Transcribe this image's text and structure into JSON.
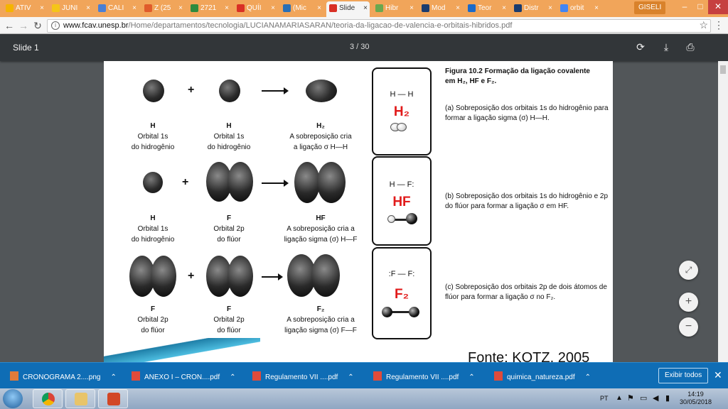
{
  "browser": {
    "tabs": [
      {
        "label": "ATIV",
        "color": "#f5b400"
      },
      {
        "label": "JUNI",
        "color": "#f5c518"
      },
      {
        "label": "CALI",
        "color": "#4a7fd4"
      },
      {
        "label": "Z (25",
        "color": "#e05b2b"
      },
      {
        "label": "2721",
        "color": "#2e8b3e"
      },
      {
        "label": "QUÍI",
        "color": "#d93025"
      },
      {
        "label": "(Mic",
        "color": "#2a6fb5"
      },
      {
        "label": "Slide",
        "color": "#d93025"
      },
      {
        "label": "Hibr",
        "color": "#6aa84f"
      },
      {
        "label": "Mod",
        "color": "#1b3c6e"
      },
      {
        "label": "Teor",
        "color": "#1b6ac9"
      },
      {
        "label": "Distr",
        "color": "#1b3c6e"
      },
      {
        "label": "orbit",
        "color": "#4285f4"
      }
    ],
    "active_tab_index": 7,
    "user": "GISELI",
    "url_host": "www.fcav.unesp.br",
    "url_path": "/Home/departamentos/tecnologia/LUCIANAMARIASARAN/teoria-da-ligacao-de-valencia-e-orbitais-hibridos.pdf"
  },
  "pdf": {
    "title": "Slide 1",
    "page_indicator": "3  /  30"
  },
  "figure": {
    "title_line1": "Figura 10.2 Formação da ligação covalente",
    "title_line2": "em H₂, HF e F₂.",
    "note_a": "(a) Sobreposição dos orbitais 1s do hidrogênio para formar a ligação sigma (σ) H—H.",
    "note_b": "(b) Sobreposição dos orbitais 1s do hidrogênio e 2p do flúor para formar a ligação σ em HF.",
    "note_c": "(c) Sobreposição dos orbitais 2p de dois átomos de flúor para formar a ligação σ no F₂.",
    "rows": [
      {
        "plus": "+",
        "c1": {
          "b": "H",
          "l1": "Orbital 1s",
          "l2": "do hidrogênio"
        },
        "c2": {
          "b": "H",
          "l1": "Orbital 1s",
          "l2": "do hidrogênio"
        },
        "c3": {
          "b": "H₂",
          "l1": "A sobreposição cria",
          "l2": "a ligação σ H—H"
        },
        "struct": "H — H",
        "formula": "H₂"
      },
      {
        "plus": "+",
        "c1": {
          "b": "H",
          "l1": "Orbital 1s",
          "l2": "do hidrogênio"
        },
        "c2": {
          "b": "F",
          "l1": "Orbital 2p",
          "l2": "do flúor"
        },
        "c3": {
          "b": "HF",
          "l1": "A sobreposição cria a",
          "l2": "ligação sigma (σ) H—F"
        },
        "struct": "H — F:",
        "formula": "HF"
      },
      {
        "plus": "+",
        "c1": {
          "b": "F",
          "l1": "Orbital 2p",
          "l2": "do flúor"
        },
        "c2": {
          "b": "F",
          "l1": "Orbital 2p",
          "l2": "do flúor"
        },
        "c3": {
          "b": "F₂",
          "l1": "A sobreposição cria a",
          "l2": "ligação sigma (σ) F—F"
        },
        "struct": ":F — F:",
        "formula": "F₂"
      }
    ],
    "source": "Fonte: KOTZ, 2005"
  },
  "downloads": {
    "items": [
      {
        "label": "CRONOGRAMA 2....png",
        "icon_color": "#e07b39"
      },
      {
        "label": "ANEXO I – CRON....pdf",
        "icon_color": "#e04b3b"
      },
      {
        "label": "Regulamento VII ....pdf",
        "icon_color": "#e04b3b"
      },
      {
        "label": "Regulamento VII ....pdf",
        "icon_color": "#e04b3b"
      },
      {
        "label": "quimica_natureza.pdf",
        "icon_color": "#e04b3b"
      }
    ],
    "show_all": "Exibir todos"
  },
  "taskbar": {
    "lang": "PT",
    "time": "14:19",
    "date": "30/05/2018"
  },
  "colors": {
    "formula_red": "#e11b1b",
    "shelf_blue": "#0f6db5",
    "pdf_toolbar": "#323639"
  }
}
